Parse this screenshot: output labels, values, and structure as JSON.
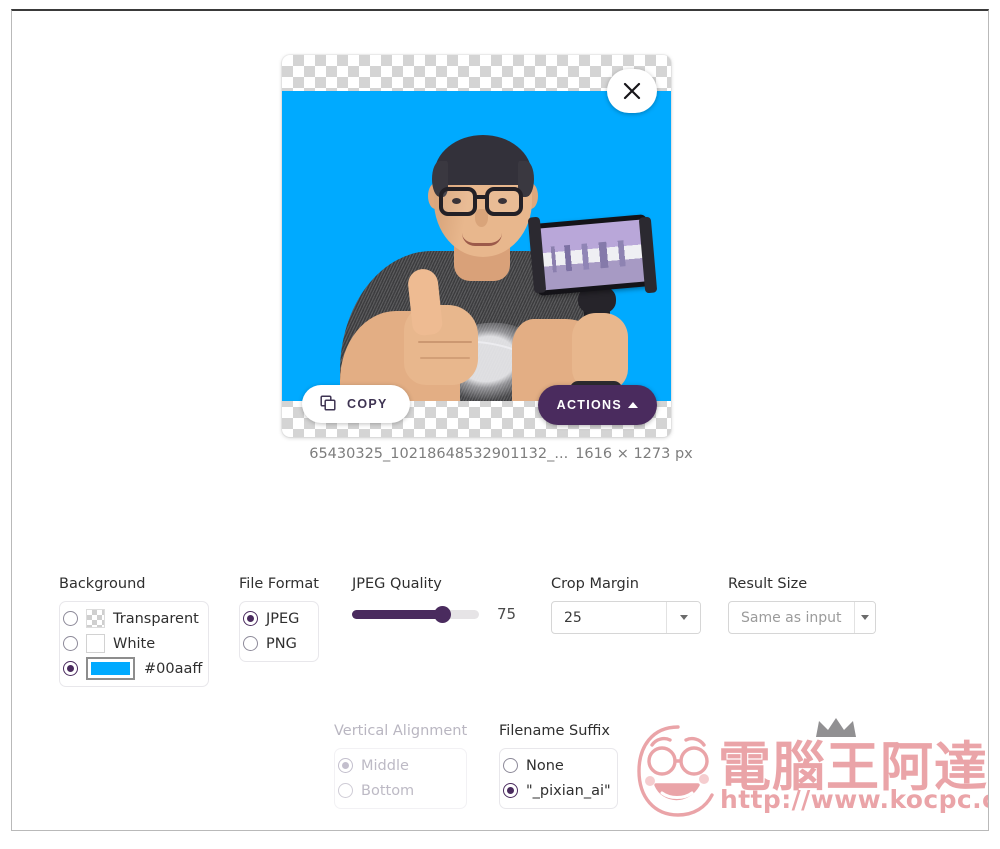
{
  "preview": {
    "close_label": "×",
    "copy_label": "COPY",
    "actions_label": "ACTIONS",
    "background_color": "#00aaff"
  },
  "file_caption": {
    "filename": "65430325_10218648532901132_...",
    "dimensions": "1616 × 1273 px"
  },
  "options": {
    "background": {
      "title": "Background",
      "items": [
        {
          "label": "Transparent",
          "swatch": "checker",
          "selected": false,
          "disabled": false
        },
        {
          "label": "White",
          "swatch": "white",
          "selected": false,
          "disabled": false
        },
        {
          "label": "#00aaff",
          "swatch": "color",
          "color": "#00aaff",
          "selected": true,
          "disabled": false
        }
      ]
    },
    "file_format": {
      "title": "File Format",
      "items": [
        {
          "label": "JPEG",
          "selected": true,
          "disabled": false
        },
        {
          "label": "PNG",
          "selected": false,
          "disabled": false
        }
      ]
    },
    "jpeg_quality": {
      "title": "JPEG Quality",
      "value": "75",
      "min": 0,
      "max": 100
    },
    "crop_margin": {
      "title": "Crop Margin",
      "value": "25"
    },
    "result_size": {
      "title": "Result Size",
      "value": "Same as input"
    },
    "vertical_alignment": {
      "title": "Vertical Alignment",
      "disabled": true,
      "items": [
        {
          "label": "Middle",
          "selected": true,
          "disabled": true
        },
        {
          "label": "Bottom",
          "selected": false,
          "disabled": true
        }
      ]
    },
    "filename_suffix": {
      "title": "Filename Suffix",
      "items": [
        {
          "label": "None",
          "selected": false,
          "disabled": false
        },
        {
          "label": "\"_pixian_ai\"",
          "selected": true,
          "disabled": false
        }
      ]
    }
  },
  "watermark": {
    "title_cn": "電腦王阿達",
    "url": "http://www.kocpc.com.tw"
  },
  "colors": {
    "accent_purple": "#4a2b5e",
    "background_blue": "#00aaff"
  }
}
